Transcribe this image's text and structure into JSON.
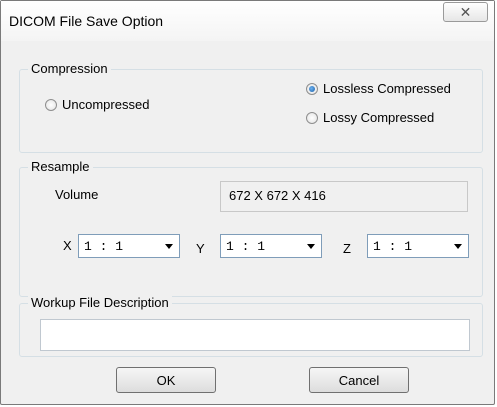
{
  "window": {
    "title": "DICOM File Save Option",
    "close_glyph": "✕"
  },
  "compression": {
    "legend": "Compression",
    "options": [
      {
        "label": "Uncompressed",
        "checked": false
      },
      {
        "label": "Lossless Compressed",
        "checked": true
      },
      {
        "label": "Lossy Compressed",
        "checked": false
      }
    ]
  },
  "resample": {
    "legend": "Resample",
    "volume_label": "Volume",
    "volume_value": "672 X 672 X 416",
    "x_label": "X",
    "y_label": "Y",
    "z_label": "Z",
    "x_value": "1 : 1",
    "y_value": "1 : 1",
    "z_value": "1 : 1"
  },
  "workup": {
    "legend": "Workup File Description",
    "value": ""
  },
  "buttons": {
    "ok": "OK",
    "cancel": "Cancel"
  }
}
